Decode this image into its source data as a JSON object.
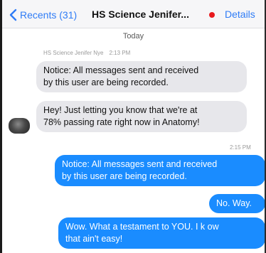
{
  "nav": {
    "back_label": "Recents (31)",
    "title": "HS Science Jenifer...",
    "details_label": "Details",
    "recording_color": "#e8191d"
  },
  "thread": {
    "date_header": "Today",
    "sender_name": "HS Science Jenifer Nye",
    "sender_time": "2:13 PM",
    "incoming": [
      {
        "line1": "Notice: All messages sent and received",
        "line2": "by this user are being recorded."
      },
      {
        "line1": "Hey! Just letting you know that we're at",
        "line2": "78% passing rate right now in Anatomy!"
      }
    ],
    "outgoing_time": "2:15 PM",
    "outgoing": [
      {
        "line1": "Notice: All messages sent and received",
        "line2": "by this user are being recorded."
      },
      {
        "line1": "No. Way."
      },
      {
        "line1": "Wow. What a testament to YOU. I k ow",
        "line2": "that ain't easy!"
      }
    ]
  },
  "icons": {
    "back": "chevron-left-icon",
    "avatar": "contact-avatar"
  }
}
